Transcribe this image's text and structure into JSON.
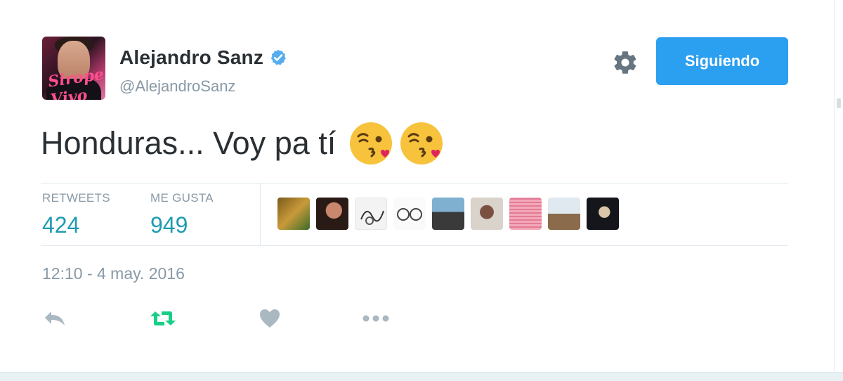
{
  "tweet": {
    "author": {
      "name": "Alejandro Sanz",
      "handle": "@AlejandroSanz",
      "verified": true,
      "avatar_text": "Sirope Vivo"
    },
    "follow_button_label": "Siguiendo",
    "text": "Honduras... Voy pa tí",
    "emojis": [
      "kissing-face-with-heart-emoji",
      "kissing-face-with-heart-emoji"
    ],
    "stats": [
      {
        "label": "RETWEETS",
        "value": "424"
      },
      {
        "label": "ME GUSTA",
        "value": "949"
      }
    ],
    "likers": [
      "liker-avatar-1",
      "liker-avatar-2",
      "liker-avatar-3",
      "liker-avatar-4",
      "liker-avatar-5",
      "liker-avatar-6",
      "liker-avatar-7",
      "liker-avatar-8",
      "liker-avatar-9"
    ],
    "timestamp": "12:10 - 4 may. 2016",
    "actions": [
      "reply-icon",
      "retweet-icon",
      "like-icon",
      "more-icon"
    ]
  },
  "colors": {
    "accent": "#2b9ff0",
    "stat_value": "#1e9bb0",
    "retweet_green": "#19cf86",
    "muted": "#8899a6",
    "text": "#292f33",
    "verified_blue": "#55acee",
    "emoji_yellow": "#f7c33c",
    "heart_pink": "#e0245e"
  }
}
